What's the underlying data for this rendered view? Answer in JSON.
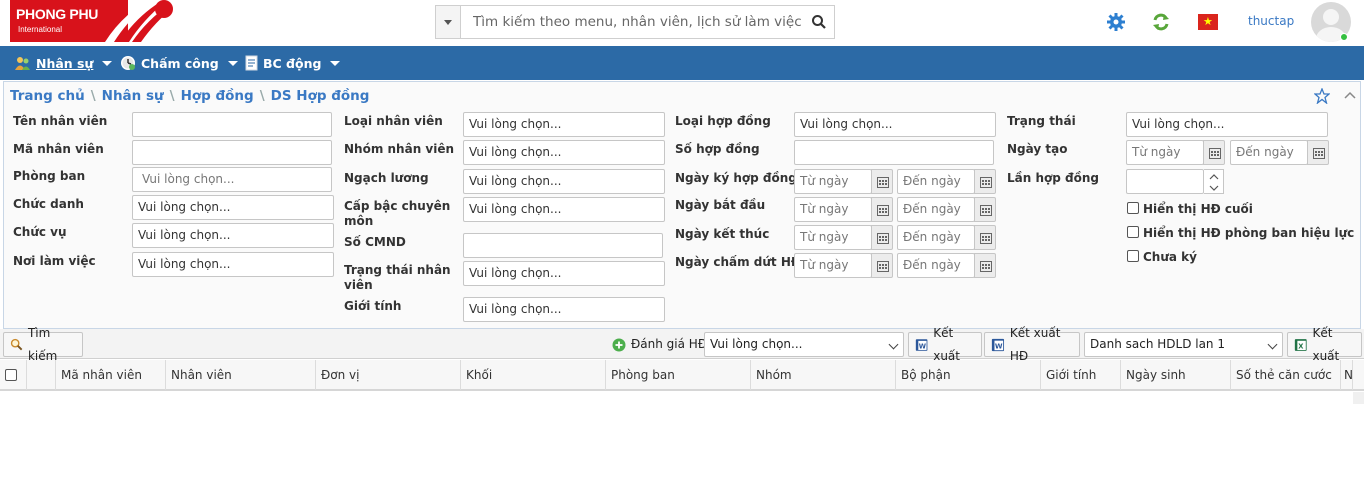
{
  "brand": {
    "name": "PHONG PHU",
    "sub": "International"
  },
  "search": {
    "placeholder": "Tìm kiếm theo menu, nhân viên, lịch sử làm việc"
  },
  "user": {
    "name": "thuctap"
  },
  "nav": [
    {
      "label": "Nhân sự",
      "icon": "people-icon"
    },
    {
      "label": "Chấm công",
      "icon": "clock-icon"
    },
    {
      "label": "BC động",
      "icon": "report-icon"
    }
  ],
  "breadcrumb": [
    "Trang chủ",
    "Nhân sự",
    "Hợp đồng",
    "DS Hợp đồng"
  ],
  "form": {
    "col1": [
      {
        "label": "Tên nhân viên",
        "value": ""
      },
      {
        "label": "Mã nhân viên",
        "value": ""
      },
      {
        "label": "Phòng ban",
        "placeholder": "Vui lòng chọn..."
      },
      {
        "label": "Chức danh",
        "value": "Vui lòng chọn..."
      },
      {
        "label": "Chức vụ",
        "value": "Vui lòng chọn..."
      },
      {
        "label": "Nơi làm việc",
        "value": "Vui lòng chọn..."
      }
    ],
    "col2": [
      {
        "label": "Loại nhân viên",
        "value": "Vui lòng chọn..."
      },
      {
        "label": "Nhóm nhân viên",
        "value": "Vui lòng chọn..."
      },
      {
        "label": "Ngạch lương",
        "value": "Vui lòng chọn..."
      },
      {
        "label": "Cấp bậc chuyên môn",
        "value": "Vui lòng chọn..."
      },
      {
        "label": "Số CMND",
        "value": ""
      },
      {
        "label": "Trạng thái nhân viên",
        "value": "Vui lòng chọn..."
      },
      {
        "label": "Giới tính",
        "value": "Vui lòng chọn..."
      }
    ],
    "col3": [
      {
        "label": "Loại hợp đồng",
        "value": "Vui lòng chọn..."
      },
      {
        "label": "Số hợp đồng",
        "value": ""
      },
      {
        "label": "Ngày ký hợp đồng",
        "from": "Từ ngày",
        "to": "Đến ngày"
      },
      {
        "label": "Ngày bắt đầu",
        "from": "Từ ngày",
        "to": "Đến ngày"
      },
      {
        "label": "Ngày kết thúc",
        "from": "Từ ngày",
        "to": "Đến ngày"
      },
      {
        "label": "Ngày chấm dứt HĐ",
        "from": "Từ ngày",
        "to": "Đến ngày"
      }
    ],
    "col4": [
      {
        "label": "Trạng thái",
        "value": "Vui lòng chọn..."
      },
      {
        "label": "Ngày tạo",
        "from": "Từ ngày",
        "to": "Đến ngày"
      },
      {
        "label": "Lần hợp đồng",
        "value": ""
      }
    ],
    "checks": [
      "Hiển thị HĐ cuối",
      "Hiển thị HĐ phòng ban hiệu lực",
      "Chưa ký"
    ]
  },
  "toolbar": {
    "search": "Tìm kiếm",
    "evaluate": "Đánh giá HĐ",
    "evaluate_select": "Vui lòng chọn...",
    "export": "Kết xuất",
    "export_hd": "Kết xuất HĐ",
    "list_select": "Danh sach HDLD lan 1",
    "export_excel": "Kết xuất"
  },
  "grid": {
    "columns": [
      "Mã nhân viên",
      "Nhân viên",
      "Đơn vị",
      "Khối",
      "Phòng ban",
      "Nhóm",
      "Bộ phận",
      "Giới tính",
      "Ngày sinh",
      "Số thẻ căn cước",
      "N"
    ]
  }
}
